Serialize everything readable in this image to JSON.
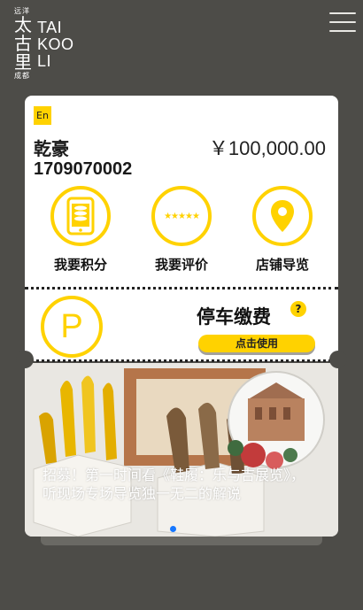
{
  "logo": {
    "top_small": "远洋",
    "han_chars": [
      "太",
      "古",
      "里"
    ],
    "bottom_small": "成都",
    "latin_lines": [
      "TAI",
      "KOO",
      "LI"
    ]
  },
  "menu": {
    "icon": "hamburger-menu-icon"
  },
  "card": {
    "lang_label": "En",
    "user_name": "乾豪",
    "user_phone": "1709070002",
    "balance": "￥100,000.00",
    "actions": [
      {
        "label": "我要积分",
        "icon": "phone-coins-icon"
      },
      {
        "label": "我要评价",
        "icon": "five-stars-icon"
      },
      {
        "label": "店铺导览",
        "icon": "location-pin-icon"
      }
    ],
    "parking": {
      "icon_letter": "P",
      "title": "停车缴费",
      "help": "?",
      "button_label": "点击使用"
    }
  },
  "banner": {
    "caption": "招募！第一时间看《鞋履：乐与吉展览》，听现场专场导览独一无二的解说",
    "active_dot": 0
  },
  "colors": {
    "accent": "#ffd200",
    "background": "#4d4c48",
    "dot_active": "#1677ff"
  }
}
